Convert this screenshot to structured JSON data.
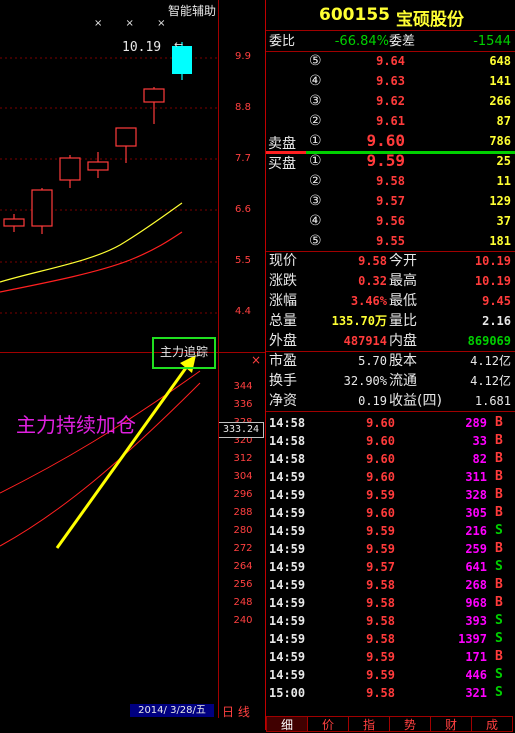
{
  "kline": {
    "assist_label": "智能辅助",
    "marks": "× × ×",
    "high_label": "10.19",
    "price_ticks": [
      "9.9",
      "8.8",
      "7.7",
      "6.6",
      "5.5",
      "4.4"
    ]
  },
  "indicator": {
    "button_label": "主力追踪",
    "close_mark": "×",
    "annotation": "主力持续加仓",
    "current_value": "333.24",
    "ticks": [
      "344",
      "336",
      "328",
      "320",
      "312",
      "304",
      "296",
      "288",
      "280",
      "272",
      "264",
      "256",
      "248",
      "240"
    ]
  },
  "footer": {
    "date": "2014/ 3/28/五",
    "period": "日 线"
  },
  "quote": {
    "code": "600155",
    "name": "宝硕股份",
    "weibi_label": "委比",
    "weibi_value": "-66.84%",
    "weicha_label": "委差",
    "weicha_value": "-1544",
    "sell_label": "卖盘",
    "buy_label": "买盘",
    "asks": [
      {
        "level": "⑤",
        "price": "9.64",
        "volume": "648"
      },
      {
        "level": "④",
        "price": "9.63",
        "volume": "141"
      },
      {
        "level": "③",
        "price": "9.62",
        "volume": "266"
      },
      {
        "level": "②",
        "price": "9.61",
        "volume": "87"
      },
      {
        "level": "①",
        "price": "9.60",
        "volume": "786"
      }
    ],
    "bids": [
      {
        "level": "①",
        "price": "9.59",
        "volume": "25"
      },
      {
        "level": "②",
        "price": "9.58",
        "volume": "11"
      },
      {
        "level": "③",
        "price": "9.57",
        "volume": "129"
      },
      {
        "level": "④",
        "price": "9.56",
        "volume": "37"
      },
      {
        "level": "⑤",
        "price": "9.55",
        "volume": "181"
      }
    ],
    "stats": [
      {
        "l1": "现价",
        "v1": "9.58",
        "c1": "red",
        "l2": "今开",
        "v2": "10.19",
        "c2": "red"
      },
      {
        "l1": "涨跌",
        "v1": "0.32",
        "c1": "red",
        "l2": "最高",
        "v2": "10.19",
        "c2": "red"
      },
      {
        "l1": "涨幅",
        "v1": "3.46%",
        "c1": "red",
        "l2": "最低",
        "v2": "9.45",
        "c2": "red"
      },
      {
        "l1": "总量",
        "v1": "135.70万",
        "c1": "yellow",
        "l2": "量比",
        "v2": "2.16",
        "c2": "white"
      },
      {
        "l1": "外盘",
        "v1": "487914",
        "c1": "red",
        "l2": "内盘",
        "v2": "869069",
        "c2": "green"
      }
    ],
    "fundamentals": [
      {
        "l1": "市盈",
        "v1": "5.70",
        "l2": "股本",
        "v2": "4.12亿"
      },
      {
        "l1": "换手",
        "v1": "32.90%",
        "l2": "流通",
        "v2": "4.12亿"
      },
      {
        "l1": "净资",
        "v1": "0.19",
        "l2": "收益(四)",
        "v2": "1.681"
      }
    ]
  },
  "trades": [
    {
      "time": "14:58",
      "price": "9.60",
      "volume": "289",
      "side": "B"
    },
    {
      "time": "14:58",
      "price": "9.60",
      "volume": "33",
      "side": "B"
    },
    {
      "time": "14:58",
      "price": "9.60",
      "volume": "82",
      "side": "B"
    },
    {
      "time": "14:59",
      "price": "9.60",
      "volume": "311",
      "side": "B"
    },
    {
      "time": "14:59",
      "price": "9.59",
      "volume": "328",
      "side": "B"
    },
    {
      "time": "14:59",
      "price": "9.60",
      "volume": "305",
      "side": "B"
    },
    {
      "time": "14:59",
      "price": "9.59",
      "volume": "216",
      "side": "S"
    },
    {
      "time": "14:59",
      "price": "9.59",
      "volume": "259",
      "side": "B"
    },
    {
      "time": "14:59",
      "price": "9.57",
      "volume": "641",
      "side": "S"
    },
    {
      "time": "14:59",
      "price": "9.58",
      "volume": "268",
      "side": "B"
    },
    {
      "time": "14:59",
      "price": "9.58",
      "volume": "968",
      "side": "B"
    },
    {
      "time": "14:59",
      "price": "9.58",
      "volume": "393",
      "side": "S"
    },
    {
      "time": "14:59",
      "price": "9.58",
      "volume": "1397",
      "side": "S"
    },
    {
      "time": "14:59",
      "price": "9.59",
      "volume": "171",
      "side": "B"
    },
    {
      "time": "14:59",
      "price": "9.59",
      "volume": "446",
      "side": "S"
    },
    {
      "time": "15:00",
      "price": "9.58",
      "volume": "321",
      "side": "S"
    }
  ],
  "bottom_tabs": [
    "细",
    "价",
    "指",
    "势",
    "财",
    "成"
  ],
  "colors": {
    "up": "#ff3b3b",
    "down": "#00d000",
    "candle_up": "#ff3b3b",
    "candle_limit": "#00ffff",
    "ma_short": "#ffff33",
    "ma_long": "#ff2020"
  }
}
